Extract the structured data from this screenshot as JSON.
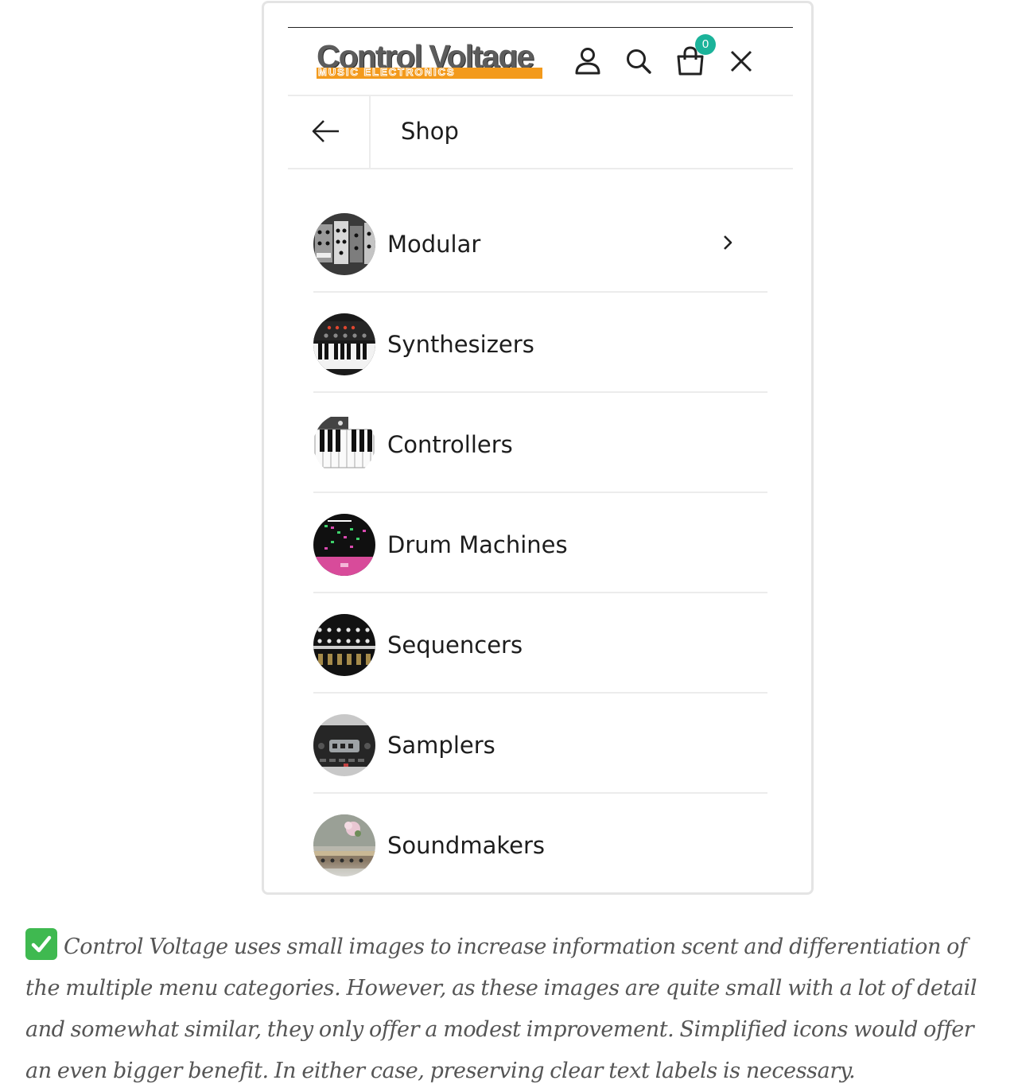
{
  "header": {
    "logo_text": "Control Voltage",
    "logo_subtext": "MUSIC ELECTRONICS",
    "cart_count": "0",
    "icons": [
      "account-icon",
      "search-icon",
      "cart-icon",
      "close-icon"
    ]
  },
  "subheader": {
    "back_icon": "arrow-left-icon",
    "title": "Shop"
  },
  "menu": {
    "items": [
      {
        "label": "Modular",
        "has_submenu": true
      },
      {
        "label": "Synthesizers"
      },
      {
        "label": "Controllers"
      },
      {
        "label": "Drum Machines"
      },
      {
        "label": "Sequencers"
      },
      {
        "label": "Samplers"
      },
      {
        "label": "Soundmakers"
      }
    ]
  },
  "caption": {
    "text": "Control Voltage uses small images to increase information scent and differentiation of the multiple menu categories. However, as these images are quite small with a lot of detail and somewhat similar, they only offer a modest improvement. Simplified icons would offer an even bigger benefit. In either case, preserving clear text labels is necessary."
  },
  "colors": {
    "logo_orange": "#f39a1c",
    "badge_teal": "#1bb39a",
    "check_green": "#3fb950",
    "divider": "#ececec"
  }
}
